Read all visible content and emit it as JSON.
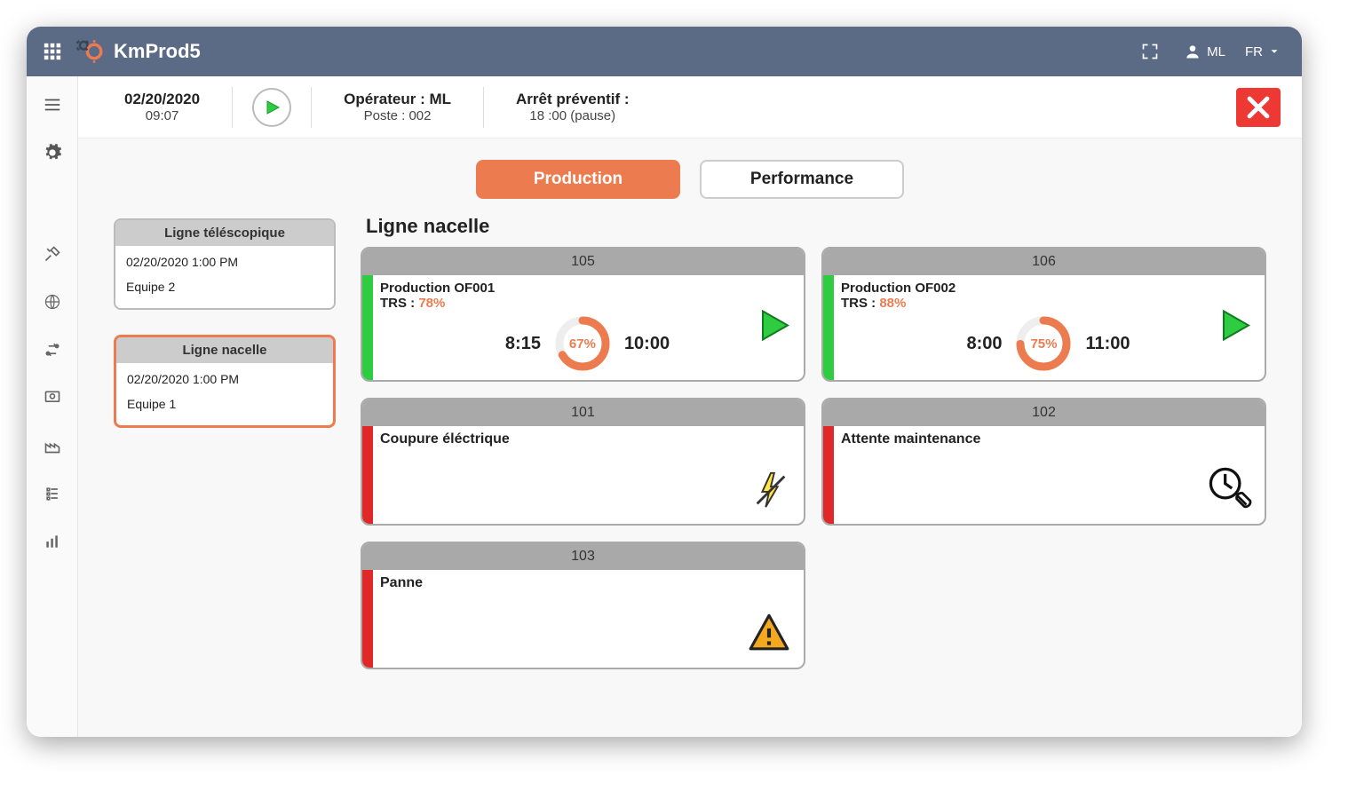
{
  "topbar": {
    "title": "KmProd5",
    "user": "ML",
    "lang": "FR"
  },
  "infobar": {
    "date": "02/20/2020",
    "time": "09:07",
    "operator_label": "Opérateur : ML",
    "poste": "Poste : 002",
    "arret_label": "Arrêt préventif :",
    "arret_value": "18 :00 (pause)"
  },
  "tabs": {
    "production": "Production",
    "performance": "Performance",
    "active": "production"
  },
  "lines": [
    {
      "name": "Ligne téléscopique",
      "datetime": "02/20/2020 1:00 PM",
      "team": "Equipe 2",
      "selected": false
    },
    {
      "name": "Ligne nacelle",
      "datetime": "02/20/2020 1:00 PM",
      "team": "Equipe 1",
      "selected": true
    }
  ],
  "selected_line_title": "Ligne nacelle",
  "machines": [
    {
      "id": "105",
      "status_color": "green",
      "kind": "prod",
      "title": "Production OF001",
      "trs_label": "TRS : ",
      "trs_value": "78%",
      "start": "8:15",
      "end": "10:00",
      "progress_pct": 67,
      "progress_label": "67%"
    },
    {
      "id": "106",
      "status_color": "green",
      "kind": "prod",
      "title": "Production OF002",
      "trs_label": "TRS : ",
      "trs_value": "88%",
      "start": "8:00",
      "end": "11:00",
      "progress_pct": 75,
      "progress_label": "75%"
    },
    {
      "id": "101",
      "status_color": "red",
      "kind": "stop",
      "title": "Coupure éléctrique",
      "icon": "bolt"
    },
    {
      "id": "102",
      "status_color": "red",
      "kind": "stop",
      "title": "Attente maintenance",
      "icon": "clock-wrench"
    },
    {
      "id": "103",
      "status_color": "red",
      "kind": "stop",
      "title": "Panne",
      "icon": "warning"
    }
  ]
}
